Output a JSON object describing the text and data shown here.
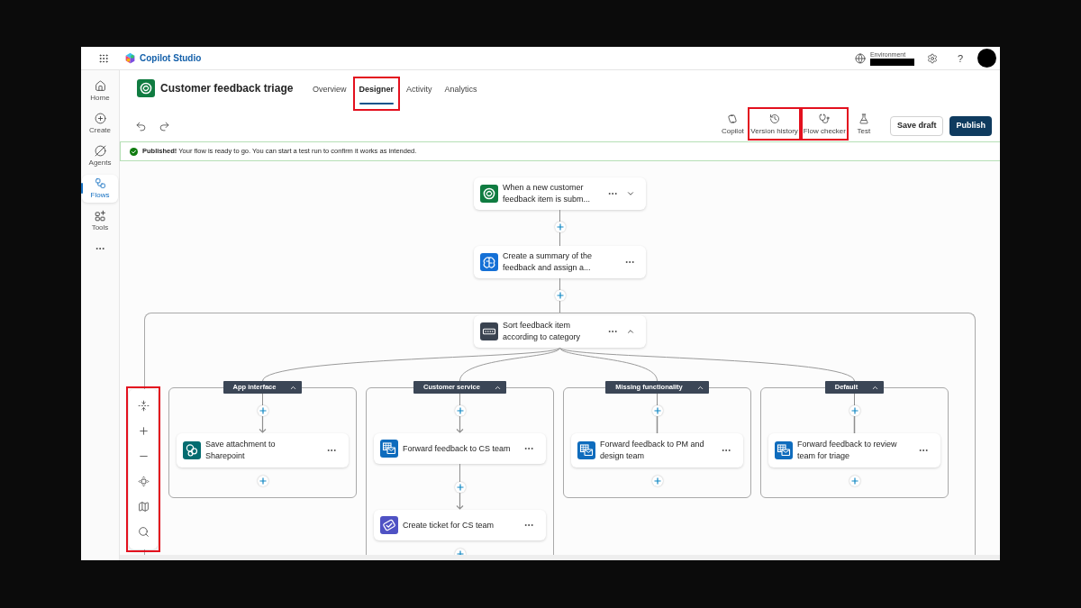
{
  "top_bar": {
    "app_name": "Copilot Studio",
    "environment_label": "Environment",
    "help_label": "?"
  },
  "nav_rail": {
    "items": [
      {
        "label": "Home",
        "selected": false
      },
      {
        "label": "Create",
        "selected": false
      },
      {
        "label": "Agents",
        "selected": false
      },
      {
        "label": "Flows",
        "selected": true
      },
      {
        "label": "Tools",
        "selected": false
      }
    ]
  },
  "header": {
    "title": "Customer feedback triage",
    "tabs": [
      {
        "label": "Overview",
        "selected": false,
        "highlighted": false
      },
      {
        "label": "Designer",
        "selected": true,
        "highlighted": true
      },
      {
        "label": "Activity",
        "selected": false,
        "highlighted": false
      },
      {
        "label": "Analytics",
        "selected": false,
        "highlighted": false
      }
    ]
  },
  "toolbar": {
    "tools": [
      {
        "label": "Copilot",
        "highlighted": false
      },
      {
        "label": "Version history",
        "highlighted": true
      },
      {
        "label": "Flow checker",
        "highlighted": true
      },
      {
        "label": "Test",
        "highlighted": false
      }
    ],
    "buttons": [
      {
        "label": "Save draft",
        "kind": "secondary"
      },
      {
        "label": "Publish",
        "kind": "primary"
      }
    ]
  },
  "banner": {
    "message": "**Published!** Your flow is ready to go. You can start a test run to confirm it works as intended."
  },
  "flow": {
    "steps": [
      {
        "kind": "trigger",
        "title": "When a new customer feedback item is subm...",
        "expanded": false
      },
      {
        "kind": "prompt",
        "title": "Create a summary of the feedback and assign a..."
      }
    ],
    "condition": {
      "kind": "switch",
      "title": "Sort feedback item according to category",
      "expanded": true,
      "branches": [
        {
          "label": "App interface",
          "expanded": true,
          "arrows": true,
          "steps": [
            {
              "kind": "sharepoint",
              "title": "Save attachment to Sharepoint"
            }
          ]
        },
        {
          "label": "Customer service",
          "expanded": true,
          "arrows": true,
          "steps": [
            {
              "kind": "email",
              "title": "Forward feedback to CS team"
            },
            {
              "kind": "ticket",
              "title": "Create ticket for CS team"
            }
          ]
        },
        {
          "label": "Missing functionality",
          "expanded": true,
          "arrows": false,
          "steps": [
            {
              "kind": "email",
              "title": "Forward feedback to PM and design team"
            }
          ]
        },
        {
          "label": "Default",
          "expanded": true,
          "arrows": false,
          "steps": [
            {
              "kind": "email",
              "title": "Forward feedback to review team for triage"
            }
          ]
        }
      ]
    }
  },
  "zoom_controls": {
    "highlighted": true
  }
}
